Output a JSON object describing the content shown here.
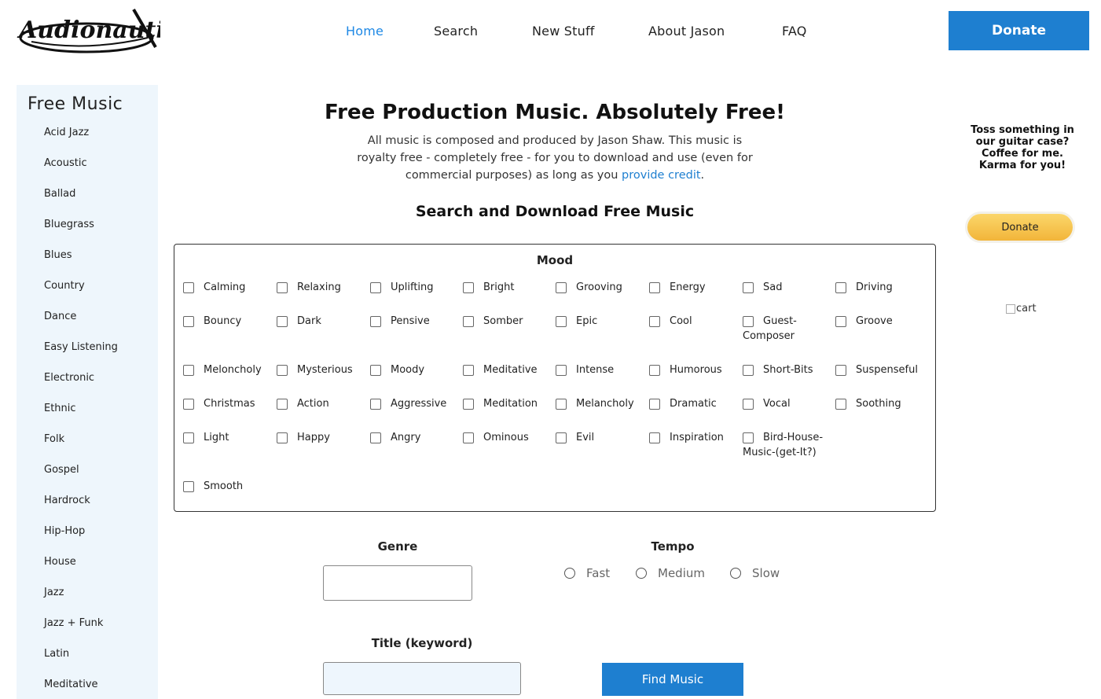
{
  "logo": {
    "text": "Audionautix"
  },
  "nav": [
    {
      "label": "Home",
      "active": true
    },
    {
      "label": "Search",
      "active": false
    },
    {
      "label": "New Stuff",
      "active": false
    },
    {
      "label": "About Jason",
      "active": false
    },
    {
      "label": "FAQ",
      "active": false
    }
  ],
  "donate_top": "Donate",
  "sidebar": {
    "title": "Free Music",
    "items": [
      "Acid Jazz",
      "Acoustic",
      "Ballad",
      "Bluegrass",
      "Blues",
      "Country",
      "Dance",
      "Easy Listening",
      "Electronic",
      "Ethnic",
      "Folk",
      "Gospel",
      "Hardrock",
      "Hip-Hop",
      "House",
      "Jazz",
      "Jazz + Funk",
      "Latin",
      "Meditative"
    ]
  },
  "main": {
    "headline": "Free Production Music. Absolutely Free!",
    "intro": "All music is composed and produced by Jason Shaw. This music is royalty free - completely free - for you to download and use (even for commercial purposes) as long as you",
    "intro_link": "provide credit",
    "intro_end": ".",
    "subhead": "Search and Download Free Music"
  },
  "mood": {
    "title": "Mood",
    "options": [
      [
        "Calming",
        "Relaxing",
        "Uplifting",
        "Bright",
        "Grooving",
        "Energy",
        "Sad",
        "Driving"
      ],
      [
        "Bouncy",
        "Dark",
        "Pensive",
        "Somber",
        "Epic",
        "Cool",
        "Guest-Composer",
        "Groove"
      ],
      [
        "Meloncholy",
        "Mysterious",
        "Moody",
        "Meditative",
        "Intense",
        "Humorous",
        "Short-Bits",
        "Suspenseful"
      ],
      [
        "Christmas",
        "Action",
        "Aggressive",
        "Meditation",
        "Melancholy",
        "Dramatic",
        "Vocal",
        "Soothing"
      ],
      [
        "Light",
        "Happy",
        "Angry",
        "Ominous",
        "Evil",
        "Inspiration",
        "Bird-House-Music-(get-It?)"
      ],
      [
        "Smooth"
      ]
    ]
  },
  "genre": {
    "label": "Genre",
    "value": ""
  },
  "tempo": {
    "label": "Tempo",
    "options": [
      "Fast",
      "Medium",
      "Slow"
    ]
  },
  "title_keyword": {
    "label": "Title (keyword)",
    "value": ""
  },
  "find_button": "Find Music",
  "right": {
    "toss": "Toss something in our guitar case? Coffee for me. Karma for you!",
    "paypal_label": "Donate",
    "cart_alt": "cart"
  }
}
